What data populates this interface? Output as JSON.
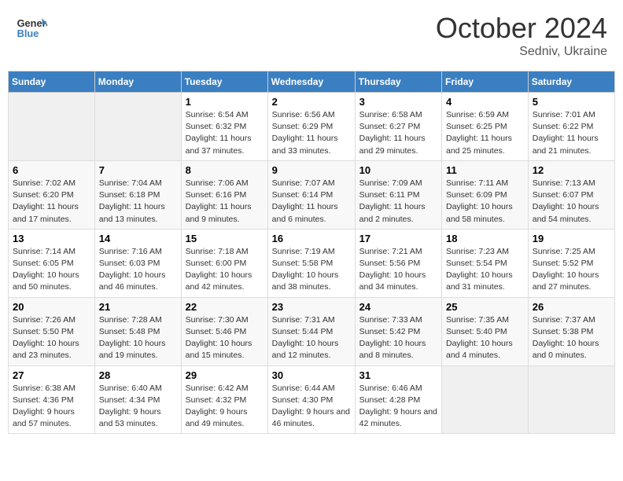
{
  "header": {
    "logo_line1": "General",
    "logo_line2": "Blue",
    "month": "October 2024",
    "location": "Sedniv, Ukraine"
  },
  "weekdays": [
    "Sunday",
    "Monday",
    "Tuesday",
    "Wednesday",
    "Thursday",
    "Friday",
    "Saturday"
  ],
  "weeks": [
    [
      {
        "day": "",
        "info": ""
      },
      {
        "day": "",
        "info": ""
      },
      {
        "day": "1",
        "info": "Sunrise: 6:54 AM\nSunset: 6:32 PM\nDaylight: 11 hours\nand 37 minutes."
      },
      {
        "day": "2",
        "info": "Sunrise: 6:56 AM\nSunset: 6:29 PM\nDaylight: 11 hours\nand 33 minutes."
      },
      {
        "day": "3",
        "info": "Sunrise: 6:58 AM\nSunset: 6:27 PM\nDaylight: 11 hours\nand 29 minutes."
      },
      {
        "day": "4",
        "info": "Sunrise: 6:59 AM\nSunset: 6:25 PM\nDaylight: 11 hours\nand 25 minutes."
      },
      {
        "day": "5",
        "info": "Sunrise: 7:01 AM\nSunset: 6:22 PM\nDaylight: 11 hours\nand 21 minutes."
      }
    ],
    [
      {
        "day": "6",
        "info": "Sunrise: 7:02 AM\nSunset: 6:20 PM\nDaylight: 11 hours\nand 17 minutes."
      },
      {
        "day": "7",
        "info": "Sunrise: 7:04 AM\nSunset: 6:18 PM\nDaylight: 11 hours\nand 13 minutes."
      },
      {
        "day": "8",
        "info": "Sunrise: 7:06 AM\nSunset: 6:16 PM\nDaylight: 11 hours\nand 9 minutes."
      },
      {
        "day": "9",
        "info": "Sunrise: 7:07 AM\nSunset: 6:14 PM\nDaylight: 11 hours\nand 6 minutes."
      },
      {
        "day": "10",
        "info": "Sunrise: 7:09 AM\nSunset: 6:11 PM\nDaylight: 11 hours\nand 2 minutes."
      },
      {
        "day": "11",
        "info": "Sunrise: 7:11 AM\nSunset: 6:09 PM\nDaylight: 10 hours\nand 58 minutes."
      },
      {
        "day": "12",
        "info": "Sunrise: 7:13 AM\nSunset: 6:07 PM\nDaylight: 10 hours\nand 54 minutes."
      }
    ],
    [
      {
        "day": "13",
        "info": "Sunrise: 7:14 AM\nSunset: 6:05 PM\nDaylight: 10 hours\nand 50 minutes."
      },
      {
        "day": "14",
        "info": "Sunrise: 7:16 AM\nSunset: 6:03 PM\nDaylight: 10 hours\nand 46 minutes."
      },
      {
        "day": "15",
        "info": "Sunrise: 7:18 AM\nSunset: 6:00 PM\nDaylight: 10 hours\nand 42 minutes."
      },
      {
        "day": "16",
        "info": "Sunrise: 7:19 AM\nSunset: 5:58 PM\nDaylight: 10 hours\nand 38 minutes."
      },
      {
        "day": "17",
        "info": "Sunrise: 7:21 AM\nSunset: 5:56 PM\nDaylight: 10 hours\nand 34 minutes."
      },
      {
        "day": "18",
        "info": "Sunrise: 7:23 AM\nSunset: 5:54 PM\nDaylight: 10 hours\nand 31 minutes."
      },
      {
        "day": "19",
        "info": "Sunrise: 7:25 AM\nSunset: 5:52 PM\nDaylight: 10 hours\nand 27 minutes."
      }
    ],
    [
      {
        "day": "20",
        "info": "Sunrise: 7:26 AM\nSunset: 5:50 PM\nDaylight: 10 hours\nand 23 minutes."
      },
      {
        "day": "21",
        "info": "Sunrise: 7:28 AM\nSunset: 5:48 PM\nDaylight: 10 hours\nand 19 minutes."
      },
      {
        "day": "22",
        "info": "Sunrise: 7:30 AM\nSunset: 5:46 PM\nDaylight: 10 hours\nand 15 minutes."
      },
      {
        "day": "23",
        "info": "Sunrise: 7:31 AM\nSunset: 5:44 PM\nDaylight: 10 hours\nand 12 minutes."
      },
      {
        "day": "24",
        "info": "Sunrise: 7:33 AM\nSunset: 5:42 PM\nDaylight: 10 hours\nand 8 minutes."
      },
      {
        "day": "25",
        "info": "Sunrise: 7:35 AM\nSunset: 5:40 PM\nDaylight: 10 hours\nand 4 minutes."
      },
      {
        "day": "26",
        "info": "Sunrise: 7:37 AM\nSunset: 5:38 PM\nDaylight: 10 hours\nand 0 minutes."
      }
    ],
    [
      {
        "day": "27",
        "info": "Sunrise: 6:38 AM\nSunset: 4:36 PM\nDaylight: 9 hours\nand 57 minutes."
      },
      {
        "day": "28",
        "info": "Sunrise: 6:40 AM\nSunset: 4:34 PM\nDaylight: 9 hours\nand 53 minutes."
      },
      {
        "day": "29",
        "info": "Sunrise: 6:42 AM\nSunset: 4:32 PM\nDaylight: 9 hours\nand 49 minutes."
      },
      {
        "day": "30",
        "info": "Sunrise: 6:44 AM\nSunset: 4:30 PM\nDaylight: 9 hours\nand 46 minutes."
      },
      {
        "day": "31",
        "info": "Sunrise: 6:46 AM\nSunset: 4:28 PM\nDaylight: 9 hours\nand 42 minutes."
      },
      {
        "day": "",
        "info": ""
      },
      {
        "day": "",
        "info": ""
      }
    ]
  ]
}
